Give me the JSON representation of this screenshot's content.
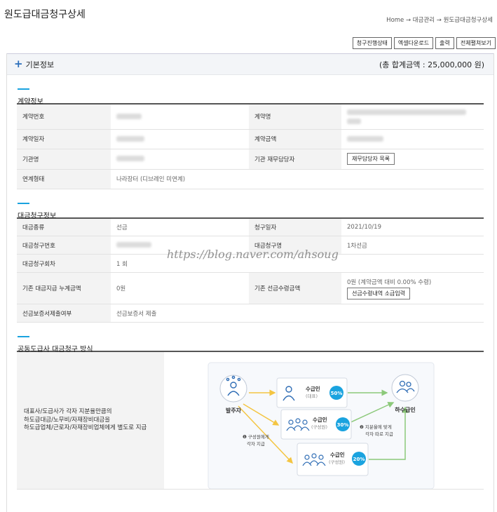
{
  "page": {
    "title": "원도급대금청구상세",
    "breadcrumb": "Home → 대금관리 → 원도급대금청구상세"
  },
  "toolbar": {
    "buttons": [
      "청구진행상태",
      "엑셀다운로드",
      "출력",
      "전체펼쳐보기"
    ]
  },
  "panel": {
    "title": "기본정보",
    "total": "(총 합계금액 : 25,000,000 원)"
  },
  "contract": {
    "title": "계약정보",
    "labels": {
      "contract_no": "계약번호",
      "contract_name": "계약명",
      "contract_date": "계약일자",
      "contract_amount": "계약금액",
      "agency": "기관명",
      "finance_manager": "기관 재무담당자",
      "link_type": "연계형태"
    },
    "finance_manager_button": "재무담당자 목록",
    "link_type_value": "나라장터 (디브레인 미연계)"
  },
  "claim": {
    "title": "대금청구정보",
    "labels": {
      "type": "대금종류",
      "claim_date": "청구일자",
      "claim_no": "대금청구번호",
      "claim_name": "대금청구명",
      "round": "대금청구회차",
      "cumulative": "기존 대금지급 누계금액",
      "advance": "기존 선금수령금액",
      "guarantee": "선금보증서제출여부"
    },
    "values": {
      "type": "선금",
      "claim_date": "2021/10/19",
      "claim_name": "1차선금",
      "round": "1 회",
      "cumulative": "0원",
      "advance": "0원  (계약금액 대비 0.00% 수령)",
      "guarantee": "선금보증서 제출"
    },
    "advance_button": "선금수령내역 소급입력"
  },
  "joint": {
    "title": "공동도급사 대금청구 방식",
    "description_lines": [
      "대표사/도급사가 각자 지분율만큼의",
      "하도급대금/노무비/자재장비대금을",
      "하도급업체/근로자/자재장비업체에게 별도로 지급"
    ],
    "diagram": {
      "orderer": "발주자",
      "recipient_label": "수급인",
      "sub_recipient": "하수급인",
      "nodes": [
        {
          "role": "(대표)",
          "percent": "50%"
        },
        {
          "role": "(구성원)",
          "percent": "30%"
        },
        {
          "role": "(구성원)",
          "percent": "20%"
        }
      ],
      "note1_line1": "❶ 구성원에게",
      "note1_line2": "각자 지급",
      "note2_line1": "❷ 지분율에 맞게",
      "note2_line2": "각자 따로 지급"
    }
  },
  "watermark": "https://blog.naver.com/ahsoug",
  "colors": {
    "accent": "#1aa3df",
    "arrow_yellow": "#f4c542",
    "arrow_green": "#8cc97a",
    "icon_blue": "#2f6db5"
  }
}
